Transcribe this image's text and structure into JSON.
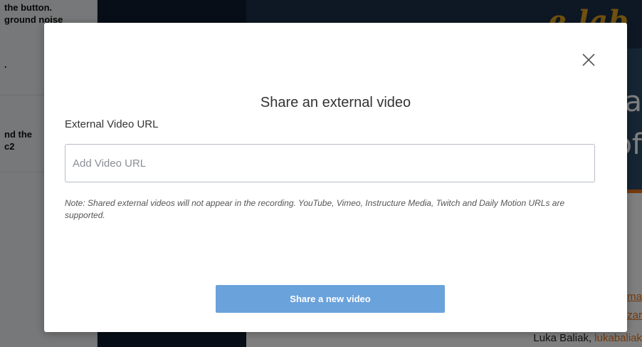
{
  "background": {
    "left_panel": {
      "item1_lines": [
        "the button.",
        "ground noise",
        "."
      ],
      "item2_lines": [
        "nd the",
        "c2"
      ]
    },
    "logo_text": "e lab",
    "hero_lines": [
      "va",
      "of"
    ],
    "side_links": [
      "ma",
      "zar"
    ],
    "footer": {
      "name": "Luka Baliak, ",
      "link": "lukabaliak"
    }
  },
  "modal": {
    "close_label": "×",
    "title": "Share an external video",
    "field_label": "External Video URL",
    "input_value": "",
    "input_placeholder": "Add Video URL",
    "note": "Note: Shared external videos will not appear in the recording. YouTube, Vimeo, Instructure Media, Twitch and Daily Motion URLs are supported.",
    "share_button": "Share a new video"
  },
  "colors": {
    "overlay": "rgba(0,0,0,0.5)",
    "button": "#6aa2dc",
    "accent_orange": "#e8751a",
    "dark_panel": "#0f1c2e"
  }
}
